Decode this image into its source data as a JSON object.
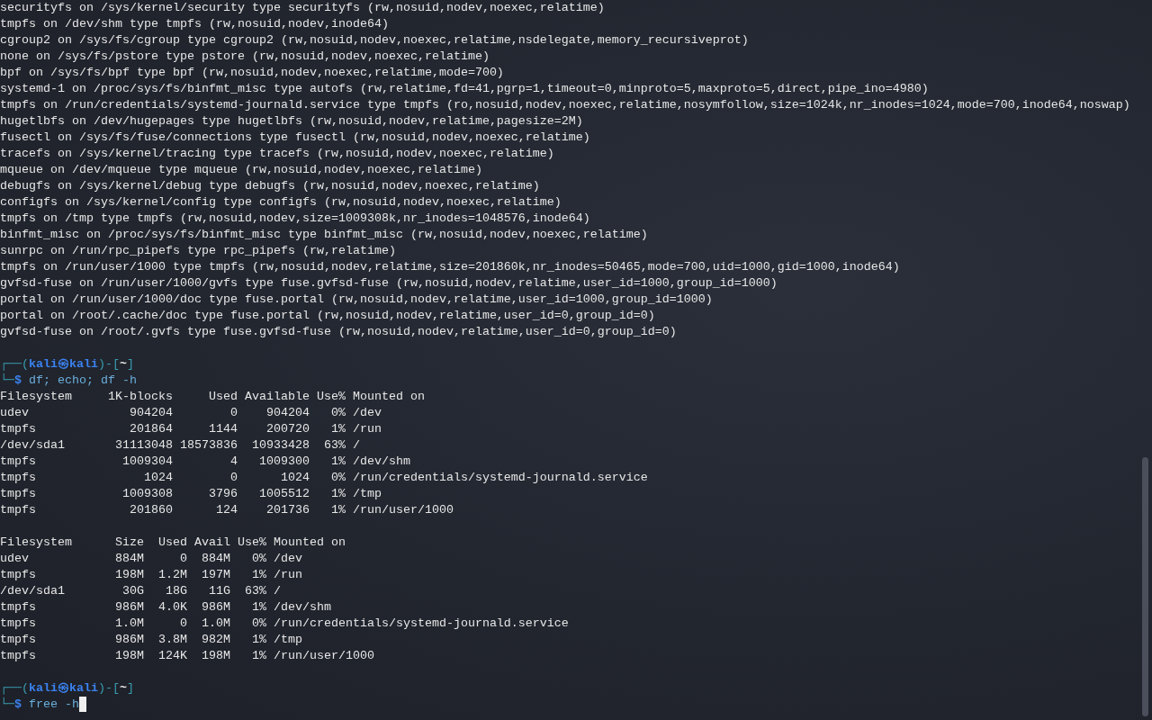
{
  "terminal": {
    "lines": [
      {
        "kind": "output",
        "text": "securityfs on /sys/kernel/security type securityfs (rw,nosuid,nodev,noexec,relatime)"
      },
      {
        "kind": "output",
        "text": "tmpfs on /dev/shm type tmpfs (rw,nosuid,nodev,inode64)"
      },
      {
        "kind": "output",
        "text": "cgroup2 on /sys/fs/cgroup type cgroup2 (rw,nosuid,nodev,noexec,relatime,nsdelegate,memory_recursiveprot)"
      },
      {
        "kind": "output",
        "text": "none on /sys/fs/pstore type pstore (rw,nosuid,nodev,noexec,relatime)"
      },
      {
        "kind": "output",
        "text": "bpf on /sys/fs/bpf type bpf (rw,nosuid,nodev,noexec,relatime,mode=700)"
      },
      {
        "kind": "output",
        "text": "systemd-1 on /proc/sys/fs/binfmt_misc type autofs (rw,relatime,fd=41,pgrp=1,timeout=0,minproto=5,maxproto=5,direct,pipe_ino=4980)"
      },
      {
        "kind": "output",
        "text": "tmpfs on /run/credentials/systemd-journald.service type tmpfs (ro,nosuid,nodev,noexec,relatime,nosymfollow,size=1024k,nr_inodes=1024,mode=700,inode64,noswap)"
      },
      {
        "kind": "output",
        "text": "hugetlbfs on /dev/hugepages type hugetlbfs (rw,nosuid,nodev,relatime,pagesize=2M)"
      },
      {
        "kind": "output",
        "text": "fusectl on /sys/fs/fuse/connections type fusectl (rw,nosuid,nodev,noexec,relatime)"
      },
      {
        "kind": "output",
        "text": "tracefs on /sys/kernel/tracing type tracefs (rw,nosuid,nodev,noexec,relatime)"
      },
      {
        "kind": "output",
        "text": "mqueue on /dev/mqueue type mqueue (rw,nosuid,nodev,noexec,relatime)"
      },
      {
        "kind": "output",
        "text": "debugfs on /sys/kernel/debug type debugfs (rw,nosuid,nodev,noexec,relatime)"
      },
      {
        "kind": "output",
        "text": "configfs on /sys/kernel/config type configfs (rw,nosuid,nodev,noexec,relatime)"
      },
      {
        "kind": "output",
        "text": "tmpfs on /tmp type tmpfs (rw,nosuid,nodev,size=1009308k,nr_inodes=1048576,inode64)"
      },
      {
        "kind": "output",
        "text": "binfmt_misc on /proc/sys/fs/binfmt_misc type binfmt_misc (rw,nosuid,nodev,noexec,relatime)"
      },
      {
        "kind": "output",
        "text": "sunrpc on /run/rpc_pipefs type rpc_pipefs (rw,relatime)"
      },
      {
        "kind": "output",
        "text": "tmpfs on /run/user/1000 type tmpfs (rw,nosuid,nodev,relatime,size=201860k,nr_inodes=50465,mode=700,uid=1000,gid=1000,inode64)"
      },
      {
        "kind": "output",
        "text": "gvfsd-fuse on /run/user/1000/gvfs type fuse.gvfsd-fuse (rw,nosuid,nodev,relatime,user_id=1000,group_id=1000)"
      },
      {
        "kind": "output",
        "text": "portal on /run/user/1000/doc type fuse.portal (rw,nosuid,nodev,relatime,user_id=1000,group_id=1000)"
      },
      {
        "kind": "output",
        "text": "portal on /root/.cache/doc type fuse.portal (rw,nosuid,nodev,relatime,user_id=0,group_id=0)"
      },
      {
        "kind": "output",
        "text": "gvfsd-fuse on /root/.gvfs type fuse.gvfsd-fuse (rw,nosuid,nodev,relatime,user_id=0,group_id=0)"
      },
      {
        "kind": "blank"
      },
      {
        "kind": "prompt",
        "segments": [
          {
            "kind": "frame",
            "text": "┌──("
          },
          {
            "kind": "user",
            "text": "kali㉿kali"
          },
          {
            "kind": "frame",
            "text": ")-["
          },
          {
            "kind": "dir",
            "text": "~"
          },
          {
            "kind": "frame",
            "text": "]"
          }
        ]
      },
      {
        "kind": "prompt",
        "cursor": false,
        "segments": [
          {
            "kind": "frame",
            "text": "└─"
          },
          {
            "kind": "symbol",
            "text": "$"
          },
          {
            "kind": "command",
            "text": "df; echo; df -h"
          }
        ]
      },
      {
        "kind": "output",
        "text": "Filesystem     1K-blocks     Used Available Use% Mounted on"
      },
      {
        "kind": "output",
        "text": "udev              904204        0    904204   0% /dev"
      },
      {
        "kind": "output",
        "text": "tmpfs             201864     1144    200720   1% /run"
      },
      {
        "kind": "output",
        "text": "/dev/sda1       31113048 18573836  10933428  63% /"
      },
      {
        "kind": "output",
        "text": "tmpfs            1009304        4   1009300   1% /dev/shm"
      },
      {
        "kind": "output",
        "text": "tmpfs               1024        0      1024   0% /run/credentials/systemd-journald.service"
      },
      {
        "kind": "output",
        "text": "tmpfs            1009308     3796   1005512   1% /tmp"
      },
      {
        "kind": "output",
        "text": "tmpfs             201860      124    201736   1% /run/user/1000"
      },
      {
        "kind": "blank"
      },
      {
        "kind": "output",
        "text": "Filesystem      Size  Used Avail Use% Mounted on"
      },
      {
        "kind": "output",
        "text": "udev            884M     0  884M   0% /dev"
      },
      {
        "kind": "output",
        "text": "tmpfs           198M  1.2M  197M   1% /run"
      },
      {
        "kind": "output",
        "text": "/dev/sda1        30G   18G   11G  63% /"
      },
      {
        "kind": "output",
        "text": "tmpfs           986M  4.0K  986M   1% /dev/shm"
      },
      {
        "kind": "output",
        "text": "tmpfs           1.0M     0  1.0M   0% /run/credentials/systemd-journald.service"
      },
      {
        "kind": "output",
        "text": "tmpfs           986M  3.8M  982M   1% /tmp"
      },
      {
        "kind": "output",
        "text": "tmpfs           198M  124K  198M   1% /run/user/1000"
      },
      {
        "kind": "blank"
      },
      {
        "kind": "prompt",
        "segments": [
          {
            "kind": "frame",
            "text": "┌──("
          },
          {
            "kind": "user",
            "text": "kali㉿kali"
          },
          {
            "kind": "frame",
            "text": ")-["
          },
          {
            "kind": "dir",
            "text": "~"
          },
          {
            "kind": "frame",
            "text": "]"
          }
        ]
      },
      {
        "kind": "prompt",
        "cursor": true,
        "segments": [
          {
            "kind": "frame",
            "text": "└─"
          },
          {
            "kind": "symbol",
            "text": "$"
          },
          {
            "kind": "command",
            "text": "free -h"
          }
        ]
      }
    ]
  }
}
